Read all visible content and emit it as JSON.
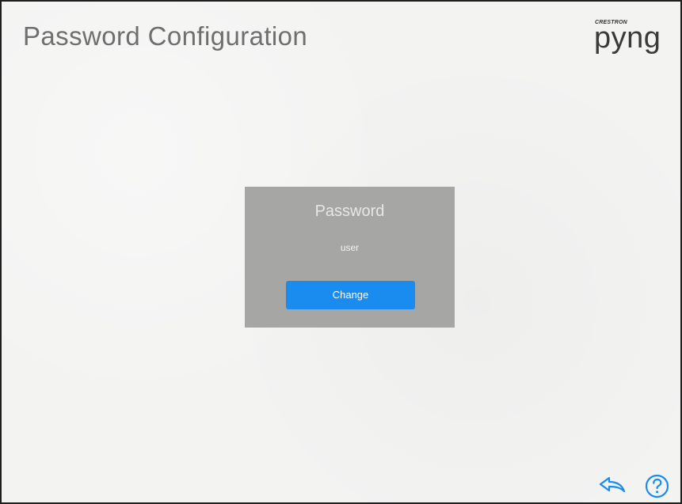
{
  "page": {
    "title": "Password Configuration"
  },
  "brand": {
    "small_text": "CRESTRON",
    "logo_word": "pyng"
  },
  "password_panel": {
    "title": "Password",
    "username": "user",
    "change_label": "Change"
  },
  "footer": {
    "back_icon": "back-arrow-icon",
    "help_icon": "help-icon"
  },
  "colors": {
    "background": "#f3f3f2",
    "panel": "#a6a6a4",
    "accent": "#1a8cf0",
    "title_text": "#6f6f6f"
  }
}
